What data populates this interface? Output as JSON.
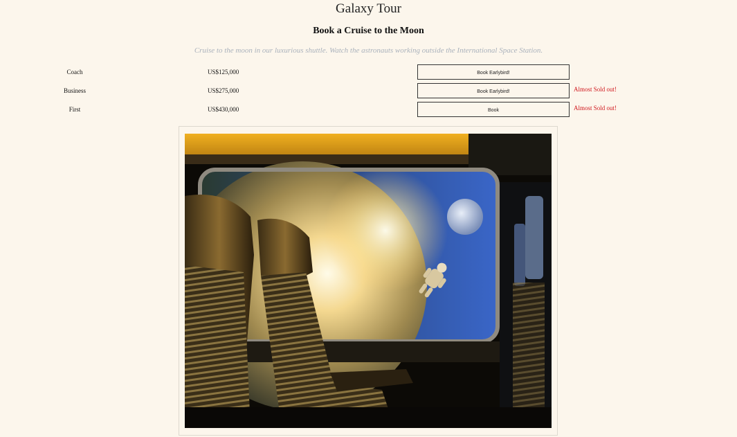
{
  "page": {
    "title": "Galaxy Tour",
    "subtitle": "Book a Cruise to the Moon",
    "description": "Cruise to the moon in our luxurious shuttle. Watch the astronauts working outside the International Space Station."
  },
  "tickets": [
    {
      "class": "Coach",
      "price": "US$125,000",
      "button": "Book Earlybird!",
      "note": ""
    },
    {
      "class": "Business",
      "price": "US$275,000",
      "button": "Book Earlybird!",
      "note": "Almost Sold out!"
    },
    {
      "class": "First",
      "price": "US$430,000",
      "button": "Book",
      "note": "Almost Sold out!"
    }
  ],
  "colors": {
    "background": "#fcf6ec",
    "description": "#aab2bc",
    "warning": "#d0161c"
  },
  "image": {
    "subject": "shuttle-cabin-window-view-of-moon-and-astronaut"
  }
}
